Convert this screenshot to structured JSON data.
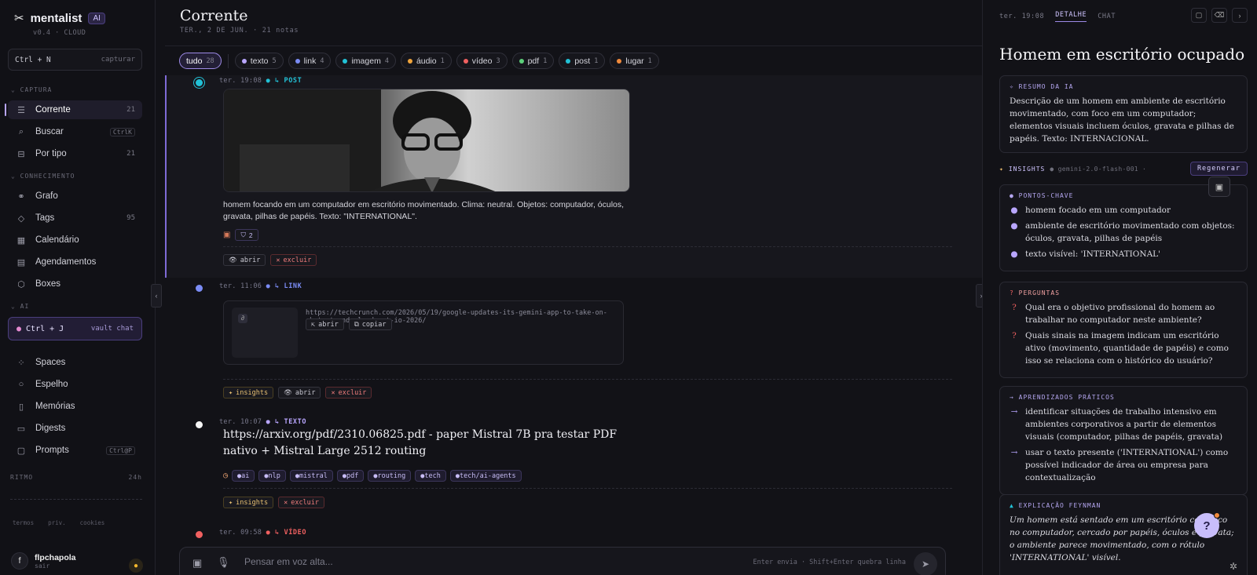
{
  "brand": {
    "name": "mentalist",
    "badge": "AI",
    "version": "v0.4 · CLOUD"
  },
  "capture": {
    "shortcut": "Ctrl + N",
    "label": "capturar"
  },
  "sections": {
    "captura": "CAPTURA",
    "conhecimento": "CONHECIMENTO",
    "ai": "AI"
  },
  "nav": {
    "corrente": {
      "label": "Corrente",
      "count": "21"
    },
    "buscar": {
      "label": "Buscar",
      "kbd": "CtrlK"
    },
    "portipo": {
      "label": "Por tipo",
      "count": "21"
    },
    "grafo": {
      "label": "Grafo"
    },
    "tags": {
      "label": "Tags",
      "count": "95"
    },
    "calendario": {
      "label": "Calendário"
    },
    "agendamentos": {
      "label": "Agendamentos"
    },
    "boxes": {
      "label": "Boxes"
    },
    "spaces": {
      "label": "Spaces"
    },
    "espelho": {
      "label": "Espelho"
    },
    "memorias": {
      "label": "Memórias"
    },
    "digests": {
      "label": "Digests"
    },
    "prompts": {
      "label": "Prompts",
      "kbd": "Ctrl@P"
    }
  },
  "vault": {
    "shortcut": "Ctrl + J",
    "label": "vault chat"
  },
  "ritmo": {
    "label": "RITMO",
    "range": "24h"
  },
  "footer_links": [
    "termos",
    "priv.",
    "cookies"
  ],
  "user": {
    "initial": "f",
    "name": "flpchapola",
    "sub": "sair"
  },
  "main": {
    "title": "Corrente",
    "subtitle": "TER., 2 DE JUN. · 21 notas"
  },
  "filters": [
    {
      "label": "tudo",
      "count": "28",
      "color": ""
    },
    {
      "label": "texto",
      "count": "5",
      "color": "#b9a6ff"
    },
    {
      "label": "link",
      "count": "4",
      "color": "#7b8cf5"
    },
    {
      "label": "imagem",
      "count": "4",
      "color": "#22c1d6"
    },
    {
      "label": "áudio",
      "count": "1",
      "color": "#f0a43c"
    },
    {
      "label": "vídeo",
      "count": "3",
      "color": "#f06060"
    },
    {
      "label": "pdf",
      "count": "1",
      "color": "#5ccf7a"
    },
    {
      "label": "post",
      "count": "1",
      "color": "#22c1d6"
    },
    {
      "label": "lugar",
      "count": "1",
      "color": "#f08a3c"
    }
  ],
  "entries": [
    {
      "time": "ter. 19:08",
      "type": "POST",
      "desc": "homem focando em um computador em escritório movimentado. Clima: neutral. Objetos: computador, óculos, gravata, pilhas de papéis. Texto: \"INTERNATIONAL\".",
      "links": "2",
      "open": "abrir",
      "delete": "excluir"
    },
    {
      "time": "ter. 11:06",
      "type": "LINK",
      "url": "https://techcrunch.com/2026/05/19/google-updates-its-gemini-app-to-take-on-chatgpt-and-claude-at-io-2026/",
      "open": "abrir",
      "copy": "copiar",
      "insights": "insights",
      "delete": "excluir"
    },
    {
      "time": "ter. 10:07",
      "type": "TEXTO",
      "title": "https://arxiv.org/pdf/2310.06825.pdf - paper Mistral 7B pra testar PDF nativo + Mistral Large 2512 routing",
      "tags": [
        "ai",
        "nlp",
        "mistral",
        "pdf",
        "routing",
        "tech",
        "tech/ai-agents"
      ],
      "insights": "insights",
      "delete": "excluir"
    },
    {
      "time": "ter. 09:58",
      "type": "VÍDEO"
    }
  ],
  "composer": {
    "placeholder": "Pensar em voz alta...",
    "hint": "Enter envia · Shift+Enter quebra linha"
  },
  "panel": {
    "time": "ter. 19:08",
    "tab_detail": "DETALHE",
    "tab_chat": "CHAT",
    "title": "Homem em escritório ocupado",
    "summary_label": "RESUMO DA IA",
    "summary": "Descrição de um homem em ambiente de escritório movimentado, com foco em um computador; elementos visuais incluem óculos, gravata e pilhas de papéis. Texto: INTERNACIONAL.",
    "insights_label": "INSIGHTS",
    "model": "gemini-2.0-flash-001 ·",
    "regen": "Regenerar",
    "key_label": "PONTOS-CHAVE",
    "key_points": [
      "homem focado em um computador",
      "ambiente de escritório movimentado com objetos: óculos, gravata, pilhas de papéis",
      "texto visível: 'INTERNATIONAL'"
    ],
    "questions_label": "PERGUNTAS",
    "questions": [
      "Qual era o objetivo profissional do homem ao trabalhar no computador neste ambiente?",
      "Quais sinais na imagem indicam um escritório ativo (movimento, quantidade de papéis) e como isso se relaciona com o histórico do usuário?"
    ],
    "learn_label": "APRENDIZADOS PRÁTICOS",
    "learnings": [
      "identificar situações de trabalho intensivo em ambientes corporativos a partir de elementos visuais (computador, pilhas de papéis, gravata)",
      "usar o texto presente ('INTERNATIONAL') como possível indicador de área ou empresa para contextualização"
    ],
    "feynman_label": "EXPLICAÇÃO FEYNMAN",
    "feynman": "Um homem está sentado em um escritório com foco no computador, cercado por papéis, óculos e gravata; o ambiente parece movimentado, com o rótulo 'INTERNATIONAL' visível."
  },
  "help": "?"
}
